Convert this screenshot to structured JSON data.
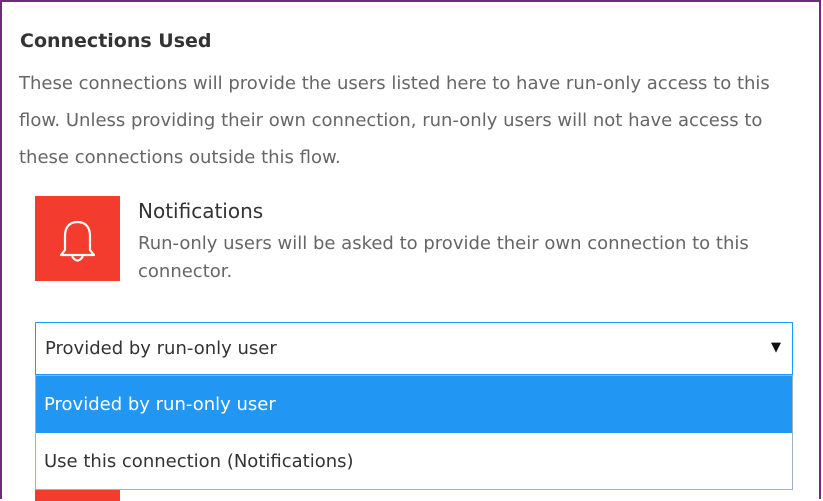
{
  "section": {
    "heading": "Connections Used",
    "description": "These connections will provide the users listed here to have run-only access to this flow. Unless providing their own connection, run-only users will not have access to these connections outside this flow."
  },
  "connection": {
    "icon": "bell-icon",
    "icon_color": "#f33b2e",
    "name": "Notifications",
    "note": "Run-only users will be asked to provide their own connection to this connector."
  },
  "select": {
    "value": "Provided by run-only user",
    "caret": "▼",
    "accent": "#2196f3",
    "options": [
      {
        "label": "Provided by run-only user",
        "selected": true
      },
      {
        "label": "Use this connection (Notifications)",
        "selected": false
      }
    ]
  }
}
